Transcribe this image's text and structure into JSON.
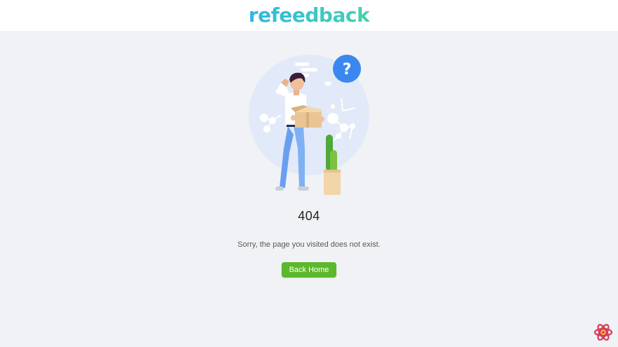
{
  "header": {
    "logo_text": "refeedback"
  },
  "result": {
    "status": "404",
    "message": "Sorry, the page you visited does not exist.",
    "back_button_label": "Back Home"
  },
  "colors": {
    "logo_gradient_start": "#2fb7e4",
    "logo_gradient_end": "#46d0b0",
    "primary_button": "#5cb82a",
    "background": "#f0f2f5"
  },
  "icons": {
    "illustration": "confused-person-with-box-illustration",
    "question": "question-mark-icon",
    "corner": "react-devtools-icon"
  }
}
